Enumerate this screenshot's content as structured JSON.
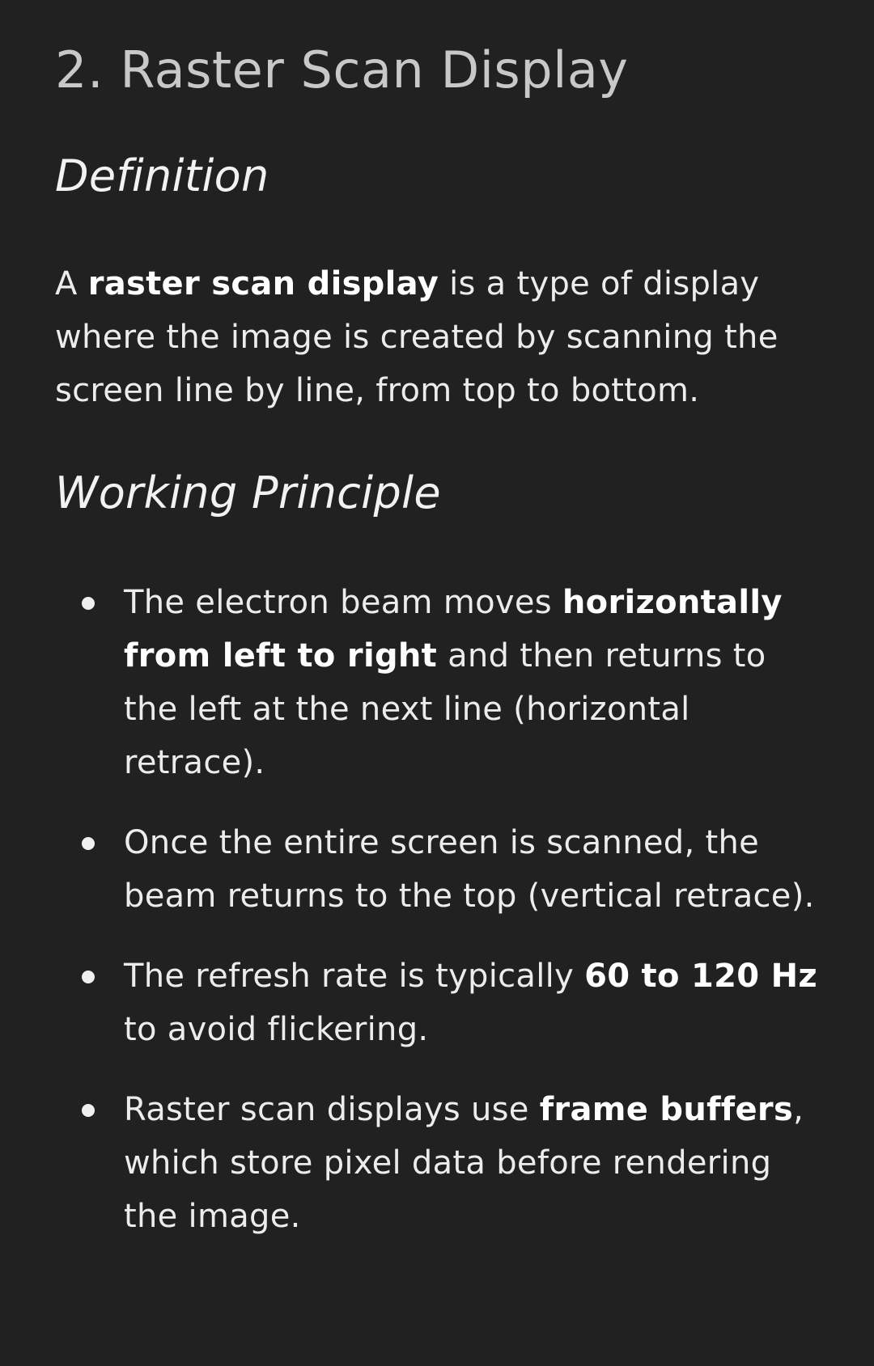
{
  "section_title": "2. Raster Scan Display",
  "definition": {
    "heading": "Definition",
    "text_before": "A ",
    "bold_term": "raster scan display",
    "text_after": " is a type of display where the image is created by scanning the screen line by line, from top to bottom."
  },
  "working_principle": {
    "heading": "Working Principle",
    "bullets": [
      {
        "before": "The electron beam moves ",
        "bold": "horizontally from left to right",
        "after": " and then returns to the left at the next line (horizontal retrace)."
      },
      {
        "before": "Once the entire screen is scanned, the beam returns to the top (vertical retrace).",
        "bold": "",
        "after": ""
      },
      {
        "before": "The refresh rate is typically ",
        "bold": "60 to 120 Hz",
        "after": " to avoid flickering."
      },
      {
        "before": "Raster scan displays use ",
        "bold": "frame buffers",
        "after": ", which store pixel data before rendering the image."
      }
    ]
  }
}
